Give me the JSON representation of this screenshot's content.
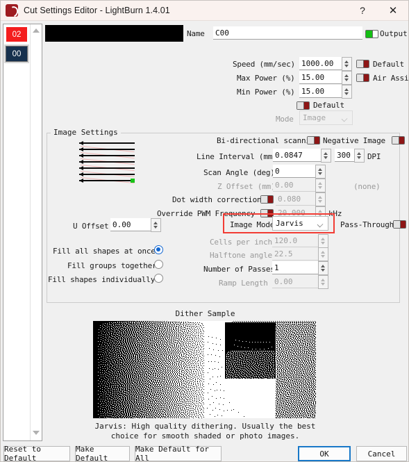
{
  "window": {
    "title": "Cut Settings Editor - LightBurn 1.4.01",
    "help_label": "?",
    "close_label": "✕",
    "app_icon": "lightburn-logo-icon"
  },
  "layers": {
    "items": [
      {
        "id": "02",
        "color": "#f41e1e",
        "selected": false
      },
      {
        "id": "00",
        "color": "#16304d",
        "selected": true
      }
    ]
  },
  "header": {
    "name_label": "Name",
    "name_value": "C00",
    "output_label": "Output",
    "output_on": true
  },
  "cut": {
    "speed_label": "Speed (mm/sec)",
    "speed_value": "1000.00",
    "speed_default_label": "Default",
    "max_power_label": "Max Power (%)",
    "max_power_value": "15.00",
    "air_assist_label": "Air Assist",
    "min_power_label": "Min Power (%)",
    "min_power_value": "15.00",
    "min_default_label": "Default",
    "mode_label": "Mode",
    "mode_value": "Image"
  },
  "image_settings": {
    "group_title": "Image Settings",
    "bidirectional_label": "Bi-directional scanning",
    "negative_image_label": "Negative Image",
    "line_interval_label": "Line Interval (mm)",
    "line_interval_value": "0.0847",
    "dpi_value": "300",
    "dpi_label": "DPI",
    "scan_angle_label": "Scan Angle (deg)",
    "scan_angle_value": "0",
    "z_offset_label": "Z Offset (mm)",
    "z_offset_value": "0.00",
    "z_offset_none": "(none)",
    "dot_width_label": "Dot width correction",
    "dot_width_value": "0.080",
    "pwm_label": "Override PWM Frequency",
    "pwm_value": "20.000",
    "pwm_unit": "kHz",
    "image_mode_label": "Image Mode",
    "image_mode_value": "Jarvis",
    "pass_through_label": "Pass-Through",
    "u_offset_label": "U Offset",
    "u_offset_value": "0.00",
    "cells_label": "Cells per inch",
    "cells_value": "120.0",
    "halftone_label": "Halftone angle",
    "halftone_value": "22.5",
    "passes_label": "Number of Passes",
    "passes_value": "1",
    "ramp_label": "Ramp Length",
    "ramp_value": "0.00",
    "fill_all_label": "Fill all shapes at once",
    "fill_groups_label": "Fill groups together",
    "fill_individual_label": "Fill shapes individually",
    "fill_selected": "fill_all"
  },
  "dither": {
    "title": "Dither Sample",
    "description_line1": "Jarvis: High quality dithering. Usually the best",
    "description_line2": "choice for smooth shaded or photo images."
  },
  "footer": {
    "reset_label": "Reset to Default",
    "make_default_label": "Make Default",
    "make_default_all_label": "Make Default for All",
    "ok_label": "OK",
    "cancel_label": "Cancel"
  },
  "colors": {
    "accent_red": "#8e1616",
    "annotation_red": "#f23c34",
    "toggle_on_green": "#14bf14",
    "focus_blue": "#1878c8",
    "radio_blue": "#1267d2"
  }
}
